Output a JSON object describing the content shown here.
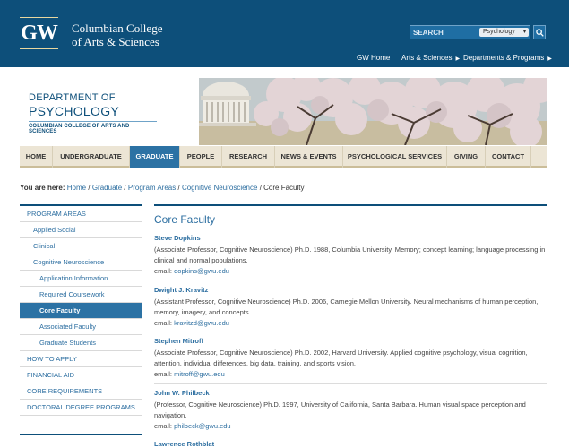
{
  "header": {
    "logo_text": "GW",
    "college_line1": "Columbian College",
    "college_line2": "of Arts & Sciences",
    "search_placeholder": "SEARCH",
    "search_scope": "Psychology",
    "top_links": [
      {
        "label": "GW Home",
        "has_arrow": false
      },
      {
        "label": "Arts & Sciences",
        "has_arrow": true
      },
      {
        "label": "Departments & Programs",
        "has_arrow": true
      }
    ]
  },
  "banner": {
    "line1": "DEPARTMENT OF",
    "line2": "PSYCHOLOGY",
    "sub": "COLUMBIAN COLLEGE OF ARTS AND SCIENCES"
  },
  "nav": {
    "items": [
      "HOME",
      "UNDERGRADUATE",
      "GRADUATE",
      "PEOPLE",
      "RESEARCH",
      "NEWS & EVENTS",
      "PSYCHOLOGICAL SERVICES",
      "GIVING",
      "CONTACT"
    ],
    "active": "GRADUATE"
  },
  "breadcrumb": {
    "lead": "You are here:",
    "links": [
      "Home",
      "Graduate",
      "Program Areas",
      "Cognitive Neuroscience"
    ],
    "current": "Core Faculty",
    "separator": "/"
  },
  "sidebar": {
    "items": [
      {
        "label": "PROGRAM AREAS",
        "level": 0
      },
      {
        "label": "Applied Social",
        "level": 1
      },
      {
        "label": "Clinical",
        "level": 1
      },
      {
        "label": "Cognitive Neuroscience",
        "level": 1
      },
      {
        "label": "Application Information",
        "level": 2
      },
      {
        "label": "Required Coursework",
        "level": 2
      },
      {
        "label": "Core Faculty",
        "level": 2,
        "active": true
      },
      {
        "label": "Associated Faculty",
        "level": 2
      },
      {
        "label": "Graduate Students",
        "level": 2
      },
      {
        "label": "HOW TO APPLY",
        "level": 0
      },
      {
        "label": "FINANCIAL AID",
        "level": 0
      },
      {
        "label": "CORE REQUIREMENTS",
        "level": 0
      },
      {
        "label": "DOCTORAL DEGREE PROGRAMS",
        "level": 0
      }
    ]
  },
  "content": {
    "title": "Core Faculty",
    "email_label": "email:",
    "faculty": [
      {
        "name": "Steve Dopkins",
        "description": "(Associate Professor, Cognitive Neuroscience) Ph.D. 1988, Columbia University. Memory; concept learning; language processing in clinical and normal populations.",
        "email": "dopkins@gwu.edu"
      },
      {
        "name": "Dwight J. Kravitz",
        "description": "(Assistant Professor, Cognitive Neuroscience) Ph.D. 2006, Carnegie Mellon University. Neural mechanisms of human perception, memory, imagery, and concepts.",
        "email": "kravitzd@gwu.edu"
      },
      {
        "name": "Stephen Mitroff",
        "description": "(Associate Professor, Cognitive Neuroscience) Ph.D. 2002, Harvard University. Applied cognitive psychology, visual cognition, attention, individual differences, big data, training, and sports vision.",
        "email": "mitroff@gwu.edu"
      },
      {
        "name": "John W. Philbeck",
        "description": "(Professor, Cognitive Neuroscience) Ph.D. 1997, University of California, Santa Barbara. Human visual space perception and navigation.",
        "email": "philbeck@gwu.edu"
      },
      {
        "name": "Lawrence Rothblat",
        "description": "",
        "email": ""
      }
    ]
  },
  "colors": {
    "header_blue": "#0d4f7a",
    "accent_blue": "#2c72a4",
    "link_blue": "#2c6ea0",
    "nav_beige": "#ece5d5"
  }
}
